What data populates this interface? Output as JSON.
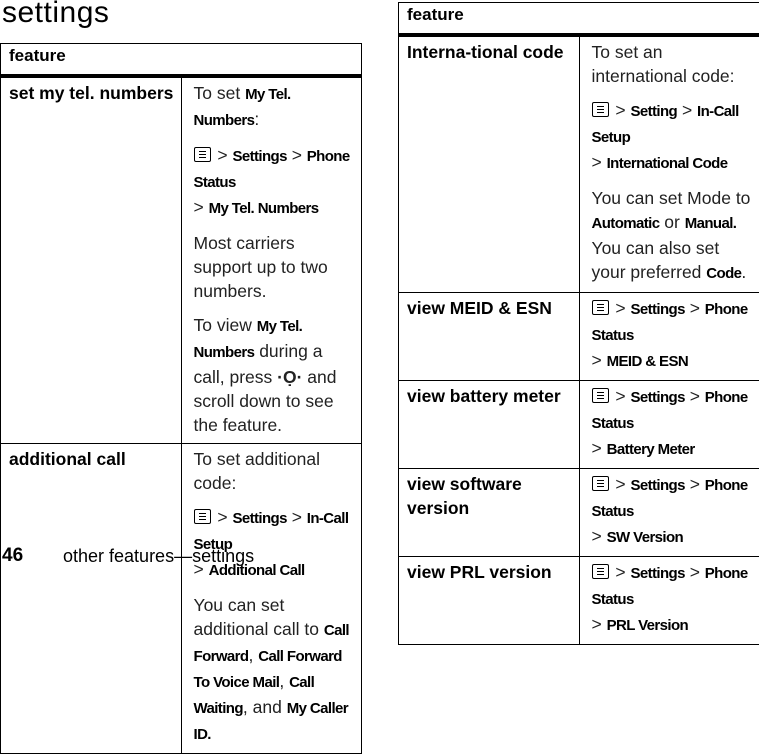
{
  "page_title": "settings",
  "left_table": {
    "header": "feature",
    "rows": [
      {
        "feature": "set my tel. numbers",
        "desc": [
          [
            {
              "t": "To set "
            },
            {
              "t": "My Tel. Numbers",
              "b": 1
            },
            {
              "t": ":"
            }
          ],
          [
            {
              "icon": "menu-key"
            },
            {
              "t": " > "
            },
            {
              "t": "Settings",
              "b": 1
            },
            {
              "t": " > "
            },
            {
              "t": "Phone Status",
              "b": 1
            },
            {
              "br": 1
            },
            {
              "t": "> "
            },
            {
              "t": "My Tel. Numbers",
              "b": 1
            }
          ],
          [
            {
              "t": "Most carriers support up to two numbers."
            }
          ],
          [
            {
              "t": "To view "
            },
            {
              "t": "My Tel. Numbers",
              "b": 1
            },
            {
              "t": " during a call, press "
            },
            {
              "icon": "nav-key"
            },
            {
              "t": " and scroll down to see the feature."
            }
          ]
        ]
      },
      {
        "feature": "additional call",
        "desc": [
          [
            {
              "t": "To set additional code:"
            }
          ],
          [
            {
              "icon": "menu-key"
            },
            {
              "t": " > "
            },
            {
              "t": "Settings",
              "b": 1
            },
            {
              "t": " > "
            },
            {
              "t": "In-Call Setup",
              "b": 1
            },
            {
              "br": 1
            },
            {
              "t": "> "
            },
            {
              "t": "Additional Call",
              "b": 1
            }
          ],
          [
            {
              "t": "You can set additional call to "
            },
            {
              "t": "Call Forward",
              "b": 1
            },
            {
              "t": ", "
            },
            {
              "t": "Call Forward To Voice Mail",
              "b": 1
            },
            {
              "t": ", "
            },
            {
              "t": "Call Waiting",
              "b": 1
            },
            {
              "t": ", and "
            },
            {
              "t": "My Caller ID.",
              "b": 1
            }
          ]
        ]
      }
    ]
  },
  "right_table": {
    "header": "feature",
    "rows": [
      {
        "feature": "Interna-tional code",
        "desc": [
          [
            {
              "t": "To set an international code:"
            }
          ],
          [
            {
              "icon": "menu-key"
            },
            {
              "t": " > "
            },
            {
              "t": "Setting",
              "b": 1
            },
            {
              "t": " > "
            },
            {
              "t": "In-Call Setup",
              "b": 1
            },
            {
              "br": 1
            },
            {
              "t": "> "
            },
            {
              "t": "International Code",
              "b": 1
            }
          ],
          [
            {
              "t": "You can set Mode to "
            },
            {
              "t": "Automatic",
              "b": 1
            },
            {
              "t": " or "
            },
            {
              "t": "Manual.",
              "b": 1
            },
            {
              "t": " You can also set your preferred "
            },
            {
              "t": "Code",
              "b": 1
            },
            {
              "t": "."
            }
          ]
        ]
      },
      {
        "feature": "view MEID & ESN",
        "desc": [
          [
            {
              "icon": "menu-key"
            },
            {
              "t": " > "
            },
            {
              "t": "Settings",
              "b": 1
            },
            {
              "t": " > "
            },
            {
              "t": "Phone Status",
              "b": 1
            },
            {
              "br": 1
            },
            {
              "t": "> "
            },
            {
              "t": "MEID & ESN",
              "b": 1
            }
          ]
        ]
      },
      {
        "feature": "view battery meter",
        "desc": [
          [
            {
              "icon": "menu-key"
            },
            {
              "t": " > "
            },
            {
              "t": "Settings",
              "b": 1
            },
            {
              "t": " > "
            },
            {
              "t": "Phone Status",
              "b": 1
            },
            {
              "br": 1
            },
            {
              "t": "> "
            },
            {
              "t": "Battery Meter",
              "b": 1
            }
          ]
        ]
      },
      {
        "feature": "view software version",
        "desc": [
          [
            {
              "icon": "menu-key"
            },
            {
              "t": " > "
            },
            {
              "t": "Settings",
              "b": 1
            },
            {
              "t": " > "
            },
            {
              "t": "Phone Status",
              "b": 1
            },
            {
              "br": 1
            },
            {
              "t": "> "
            },
            {
              "t": "SW Version",
              "b": 1
            }
          ]
        ]
      },
      {
        "feature": "view PRL version",
        "desc": [
          [
            {
              "icon": "menu-key"
            },
            {
              "t": " > "
            },
            {
              "t": "Settings",
              "b": 1
            },
            {
              "t": " > "
            },
            {
              "t": "Phone Status",
              "b": 1
            },
            {
              "br": 1
            },
            {
              "t": "> "
            },
            {
              "t": "PRL Version",
              "b": 1
            }
          ]
        ]
      }
    ]
  },
  "footer": {
    "page_number": "46",
    "section": "other features—settings"
  }
}
